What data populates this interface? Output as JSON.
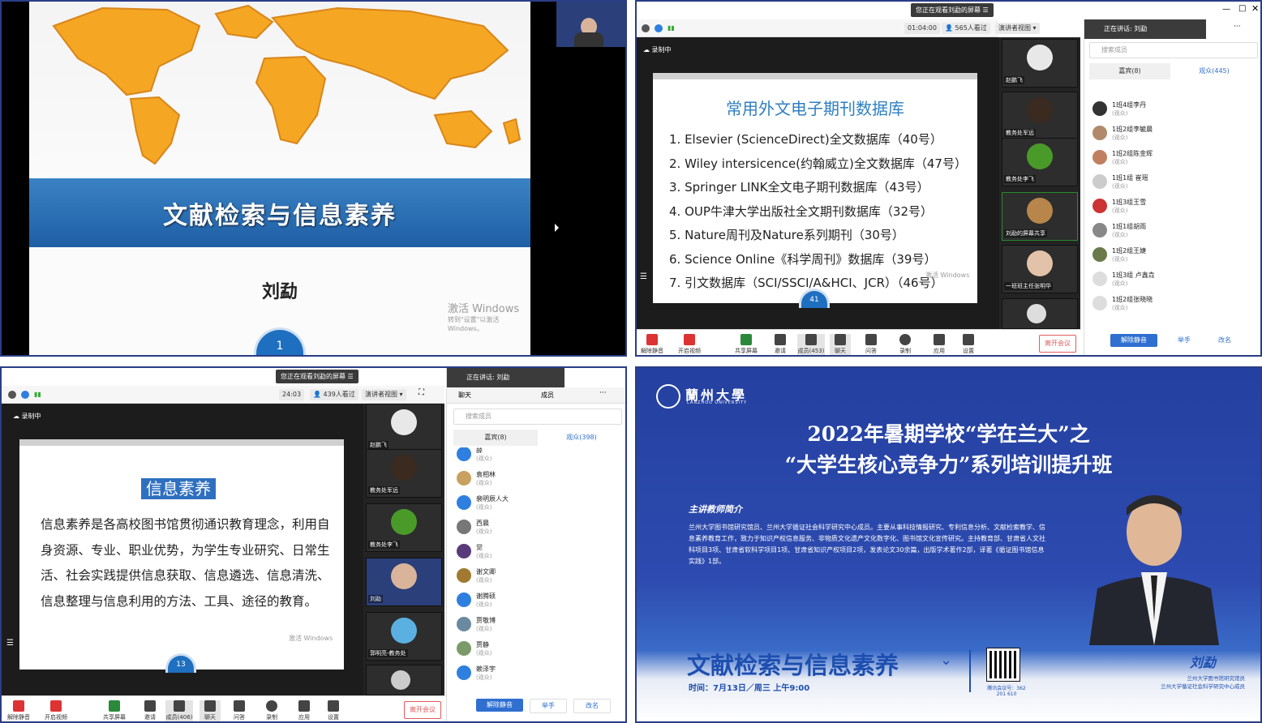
{
  "q1": {
    "slide_title": "文献检索与信息素养",
    "author": "刘勐",
    "watermark_main": "激活 Windows",
    "watermark_sub": "转到\"设置\"以激活 Windows。",
    "page": "1"
  },
  "q2": {
    "sharing_label": "您正在观看刘勐的屏幕",
    "timer": "01:04:00",
    "viewers": "565人看过",
    "view_mode": "演讲者视图",
    "recording": "录制中",
    "speaking": "正在讲话: 刘勐",
    "slide_title": "常用外文电子期刊数据库",
    "slide_items": [
      "1. Elsevier (ScienceDirect)全文数据库（40号）",
      "2. Wiley intersicence(约翰威立)全文数据库（47号）",
      "3. Springer LINK全文电子期刊数据库（43号）",
      "4. OUP牛津大学出版社全文期刊数据库（32号）",
      "5. Nature周刊及Nature系列期刊（30号）",
      "6. Science Online《科学周刊》数据库（39号）",
      "7. 引文数据库（SCI/SSCI/A&HCI、JCR）（46号）"
    ],
    "watermark": "激活 Windows",
    "page": "41",
    "videos": [
      "赵鹏飞",
      "教务处军远",
      "教务处李飞",
      "刘勐的屏幕共享",
      "一班班主任张明华",
      ""
    ],
    "search_placeholder": "搜索成员",
    "tab_guests": "嘉宾(8)",
    "tab_audience": "观众(445)",
    "members": [
      {
        "name": "1班4组李丹",
        "role": "(观众)"
      },
      {
        "name": "1班2组李毓晨",
        "role": "(观众)"
      },
      {
        "name": "1班2组陈金辉",
        "role": "(观众)"
      },
      {
        "name": "1班1组 崔瑶",
        "role": "(观众)"
      },
      {
        "name": "1班3组王雪",
        "role": "(观众)"
      },
      {
        "name": "1班1组胡雨",
        "role": "(观众)"
      },
      {
        "name": "1班2组王婕",
        "role": "(观众)"
      },
      {
        "name": "1班3组 卢鑫垚",
        "role": "(观众)"
      },
      {
        "name": "1班2组张晓晓",
        "role": "(观众)"
      }
    ],
    "toolbar": [
      "解除静音",
      "开启视频",
      "共享屏幕",
      "邀请",
      "成员(453)",
      "聊天",
      "问答",
      "录制",
      "应用",
      "设置"
    ],
    "leave": "离开会议",
    "panel_buttons": [
      "解除静音",
      "举手",
      "改名"
    ]
  },
  "q3": {
    "sharing_label": "您正在观看刘勐的屏幕",
    "timer": "24:03",
    "viewers": "439人看过",
    "view_mode": "演讲者视图",
    "recording": "录制中",
    "speaking": "正在讲话: 刘勐",
    "tab_chat": "聊天",
    "tab_members": "成员",
    "slide_heading": "信息素养",
    "slide_text": "信息素养是各高校图书馆贯彻通识教育理念，利用自身资源、专业、职业优势，为学生专业研究、日常生活、社会实践提供信息获取、信息遴选、信息清洗、信息整理与信息利用的方法、工具、途径的教育。",
    "watermark": "激活 Windows",
    "page": "13",
    "videos": [
      "赵鹏飞",
      "教务处军远",
      "教务处李飞",
      "刘勐",
      "郭明亮-教务处",
      ""
    ],
    "search_placeholder": "搜索成员",
    "tab_guests": "嘉宾(8)",
    "tab_audience": "观众(398)",
    "members": [
      {
        "name": "薛",
        "role": "(观众)"
      },
      {
        "name": "袁相林",
        "role": "(观众)"
      },
      {
        "name": "裴明辰人大",
        "role": "(观众)"
      },
      {
        "name": "西晨",
        "role": "(观众)"
      },
      {
        "name": "觉",
        "role": "(观众)"
      },
      {
        "name": "谢文卿",
        "role": "(观众)"
      },
      {
        "name": "谢腾硕",
        "role": "(观众)"
      },
      {
        "name": "贾敬博",
        "role": "(观众)"
      },
      {
        "name": "贾静",
        "role": "(观众)"
      },
      {
        "name": "赖泽宇",
        "role": "(观众)"
      }
    ],
    "toolbar": [
      "解除静音",
      "开启视频",
      "共享屏幕",
      "邀请",
      "成员(406)",
      "聊天",
      "问答",
      "录制",
      "应用",
      "设置"
    ],
    "leave": "离开会议",
    "panel_buttons": [
      "解除静音",
      "举手",
      "改名"
    ]
  },
  "q4": {
    "university": "蘭州大學",
    "university_en": "LANZHOU UNIVERSITY",
    "title_line1": "2022年暑期学校“学在兰大”之",
    "title_line2": "“大学生核心竞争力”系列培训提升班",
    "intro_heading": "主讲教师简介",
    "intro": "兰州大学图书馆研究馆员、兰州大学循证社会科学研究中心成员。主要从事科技情报研究、专利信息分析、文献检索教学、信息素养教育工作，致力于知识产权信息服务、非物质文化遗产文化数字化、图书馆文化宣传研究。主持教育部、甘肃省人文社科项目3项、甘肃省软科学项目1项、甘肃省知识产权项目2项，发表论文30余篇，出版学术著作2部，译著《循证图书馆信息实践》1部。",
    "course": "文献检索与信息素养",
    "time": "时间：7月13日／周三 上午9:00",
    "qr_label": "腾讯会议号：362 201 610",
    "speaker_name": "刘勐",
    "affiliation1": "兰州大学图书馆研究馆员",
    "affiliation2": "兰州大学循证社会科学研究中心成员"
  }
}
